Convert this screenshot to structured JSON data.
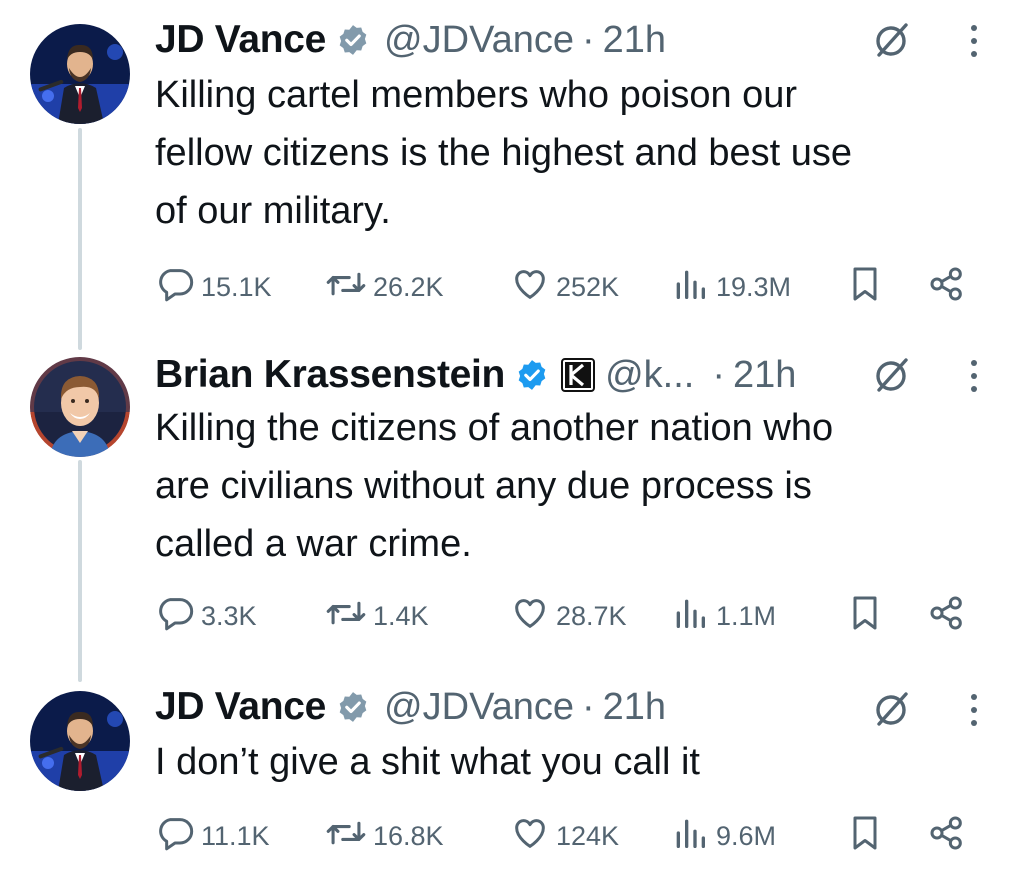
{
  "colors": {
    "text": "#0f1419",
    "secondary": "#536471",
    "verified_gray": "#829aab",
    "verified_blue": "#1d9bf0",
    "thread_line": "#cfd9de"
  },
  "tweets": [
    {
      "name": "JD Vance",
      "verified": "gray",
      "handle": "@JDVance",
      "separator": "·",
      "time": "21h",
      "text": "Killing cartel members who poison our\nfellow citizens is the highest and best use\nof our military.",
      "stats": {
        "replies": "15.1K",
        "reposts": "26.2K",
        "likes": "252K",
        "views": "19.3M"
      }
    },
    {
      "name": "Brian Krassenstein",
      "verified": "blue",
      "affiliate_badge": "K",
      "handle": "@k...",
      "separator": "·",
      "time": "21h",
      "text": "Killing the citizens of another nation who\nare civilians without any due process is\ncalled a war crime.",
      "stats": {
        "replies": "3.3K",
        "reposts": "1.4K",
        "likes": "28.7K",
        "views": "1.1M"
      }
    },
    {
      "name": "JD Vance",
      "verified": "gray",
      "handle": "@JDVance",
      "separator": "·",
      "time": "21h",
      "text": "I don’t give a shit what you call it",
      "stats": {
        "replies": "11.1K",
        "reposts": "16.8K",
        "likes": "124K",
        "views": "9.6M"
      }
    }
  ]
}
